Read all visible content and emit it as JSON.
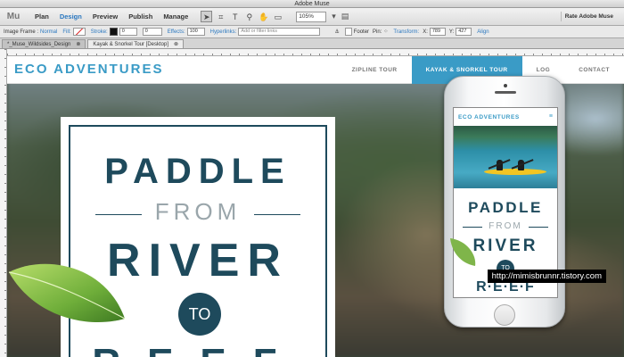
{
  "window": {
    "title": "Adobe Muse"
  },
  "menubar": {
    "logo": "Mu",
    "items": [
      "Plan",
      "Design",
      "Preview",
      "Publish",
      "Manage"
    ],
    "active": "Design",
    "zoom": "105%",
    "rate_label": "Rate Adobe Muse"
  },
  "controlbar": {
    "image_frame_label": "Image Frame :",
    "image_frame_value": "Normal",
    "fill_label": "Fill:",
    "stroke_label": "Stroke:",
    "stroke_value": "0",
    "corner_value": "0",
    "effects_label": "Effects:",
    "opacity_value": "100",
    "hyperlinks_label": "Hyperlinks:",
    "hyperlinks_placeholder": "Add or filter links",
    "footer_label": "Footer",
    "pin_label": "Pin:",
    "transform_label": "Transform:",
    "x_label": "X:",
    "x_value": "789",
    "y_label": "Y:",
    "y_value": "427",
    "align_label": "Align"
  },
  "tabs": [
    {
      "label": "*_Muse_Wildsides_Design"
    },
    {
      "label": "Kayak & Snorkel Tour [Desktop]"
    }
  ],
  "site": {
    "logo": "ECO ADVENTURES",
    "nav": [
      "ZIPLINE TOUR",
      "KAYAK & SNORKEL TOUR",
      "LOG",
      "CONTACT"
    ],
    "active_nav": "KAYAK & SNORKEL TOUR"
  },
  "poster": {
    "line1": "PADDLE",
    "from": "FROM",
    "line2": "RIVER",
    "to": "TO",
    "line3": "REEF"
  },
  "mobile": {
    "logo": "ECO ADVENTURES",
    "menu_icon": "≡",
    "line1": "PADDLE",
    "from": "FROM",
    "line2": "RIVER",
    "to": "TO",
    "line3": "R·E·E·F"
  },
  "watermark": "http://mimisbrunnr.tistory.com",
  "colors": {
    "accent_blue": "#3a9bc6",
    "navy": "#1e4a5c",
    "menu_active": "#2b78c0"
  }
}
